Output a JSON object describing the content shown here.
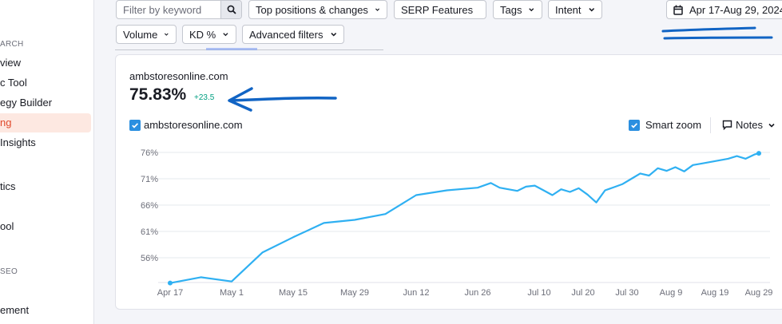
{
  "sidebar": {
    "items": [
      {
        "label": "ARCH",
        "kind": "section"
      },
      {
        "label": "view",
        "kind": "item"
      },
      {
        "label": "c Tool",
        "kind": "item"
      },
      {
        "label": "egy Builder",
        "kind": "item"
      },
      {
        "label": "ng",
        "kind": "active"
      },
      {
        "label": " Insights",
        "kind": "item"
      },
      {
        "label": "tics",
        "kind": "item"
      },
      {
        "label": "ool",
        "kind": "item"
      },
      {
        "label": " SEO",
        "kind": "section"
      },
      {
        "label": "ement",
        "kind": "item"
      }
    ]
  },
  "filters": {
    "search_placeholder": "Filter by keyword",
    "top_positions": "Top positions & changes",
    "serp_features": "SERP Features",
    "tags": "Tags",
    "intent": "Intent",
    "volume": "Volume",
    "kd": "KD %",
    "advanced": "Advanced filters",
    "date_range": "Apr 17-Aug 29, 2024"
  },
  "card": {
    "domain": "ambstoresonline.com",
    "value": "75.83%",
    "delta": "+23.5",
    "legend_label": "ambstoresonline.com",
    "smart_zoom": "Smart zoom",
    "notes": "Notes"
  },
  "colors": {
    "line": "#2fb0f2",
    "checkbox": "#2b8fe0",
    "annotation": "#1164c4",
    "delta": "#009f81",
    "active_nav": "#e0492b"
  },
  "chart_data": {
    "type": "line",
    "series": [
      {
        "name": "ambstoresonline.com",
        "x": [
          "Apr 17",
          "Apr 24",
          "May 1",
          "May 8",
          "May 15",
          "May 22",
          "May 29",
          "Jun 5",
          "Jun 12",
          "Jun 19",
          "Jun 26",
          "Jun 29",
          "Jul 1",
          "Jul 3",
          "Jul 5",
          "Jul 7",
          "Jul 9",
          "Jul 11",
          "Jul 13",
          "Jul 15",
          "Jul 17",
          "Jul 19",
          "Jul 21",
          "Jul 23",
          "Jul 25",
          "Jul 27",
          "Jul 29",
          "Jul 31",
          "Aug 2",
          "Aug 4",
          "Aug 6",
          "Aug 8",
          "Aug 10",
          "Aug 12",
          "Aug 14",
          "Aug 16",
          "Aug 18",
          "Aug 20",
          "Aug 22",
          "Aug 24",
          "Aug 26",
          "Aug 28",
          "Aug 29"
        ],
        "y": [
          51.2,
          52.3,
          51.5,
          57.0,
          59.9,
          62.6,
          63.2,
          64.3,
          67.9,
          68.8,
          69.3,
          70.2,
          69.3,
          69.0,
          68.7,
          69.5,
          69.7,
          68.8,
          67.9,
          69.0,
          68.5,
          69.2,
          68.0,
          66.5,
          68.8,
          69.4,
          70.0,
          71.0,
          72.0,
          71.6,
          73.0,
          72.5,
          73.2,
          72.4,
          73.6,
          73.9,
          74.2,
          74.5,
          74.8,
          75.3,
          74.8,
          75.6,
          75.83
        ]
      }
    ],
    "x_ticks": [
      "Apr 17",
      "May 1",
      "May 15",
      "May 29",
      "Jun 12",
      "Jun 26",
      "Jul 10",
      "Jul 20",
      "Jul 30",
      "Aug 9",
      "Aug 19",
      "Aug 29"
    ],
    "y_ticks": [
      "76%",
      "71%",
      "66%",
      "61%",
      "56%"
    ],
    "ylim": [
      51,
      76
    ],
    "grid": true
  }
}
